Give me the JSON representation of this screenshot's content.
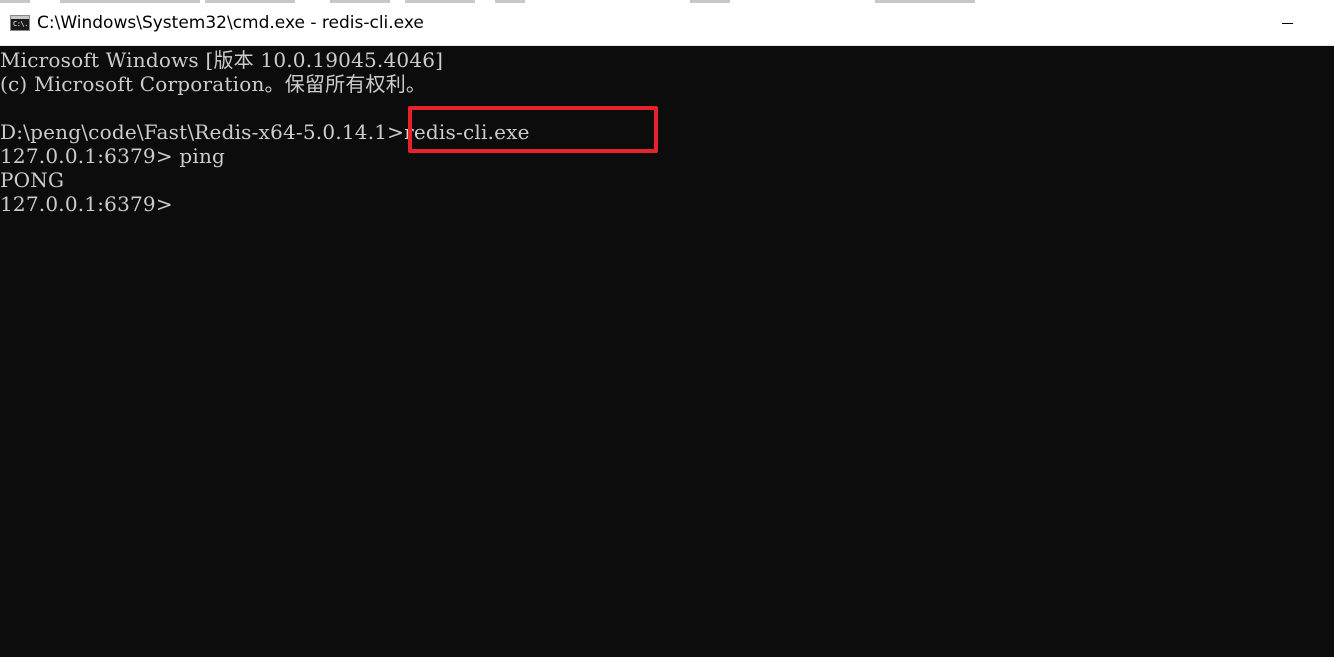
{
  "window": {
    "title": "C:\\Windows\\System32\\cmd.exe - redis-cli.exe",
    "icon": "cmd-icon",
    "icon_text": "C:\\."
  },
  "console": {
    "lines": [
      "Microsoft Windows [版本 10.0.19045.4046]",
      "(c) Microsoft Corporation。保留所有权利。",
      "",
      "D:\\peng\\code\\Fast\\Redis-x64-5.0.14.1>redis-cli.exe",
      "127.0.0.1:6379> ping",
      "PONG",
      "127.0.0.1:6379>"
    ]
  },
  "annotation": {
    "color": "#e8222a",
    "target": "redis-cli.exe"
  },
  "colors": {
    "console_bg": "#0c0c0c",
    "console_fg": "#cccccc",
    "titlebar_bg": "#ffffff"
  }
}
